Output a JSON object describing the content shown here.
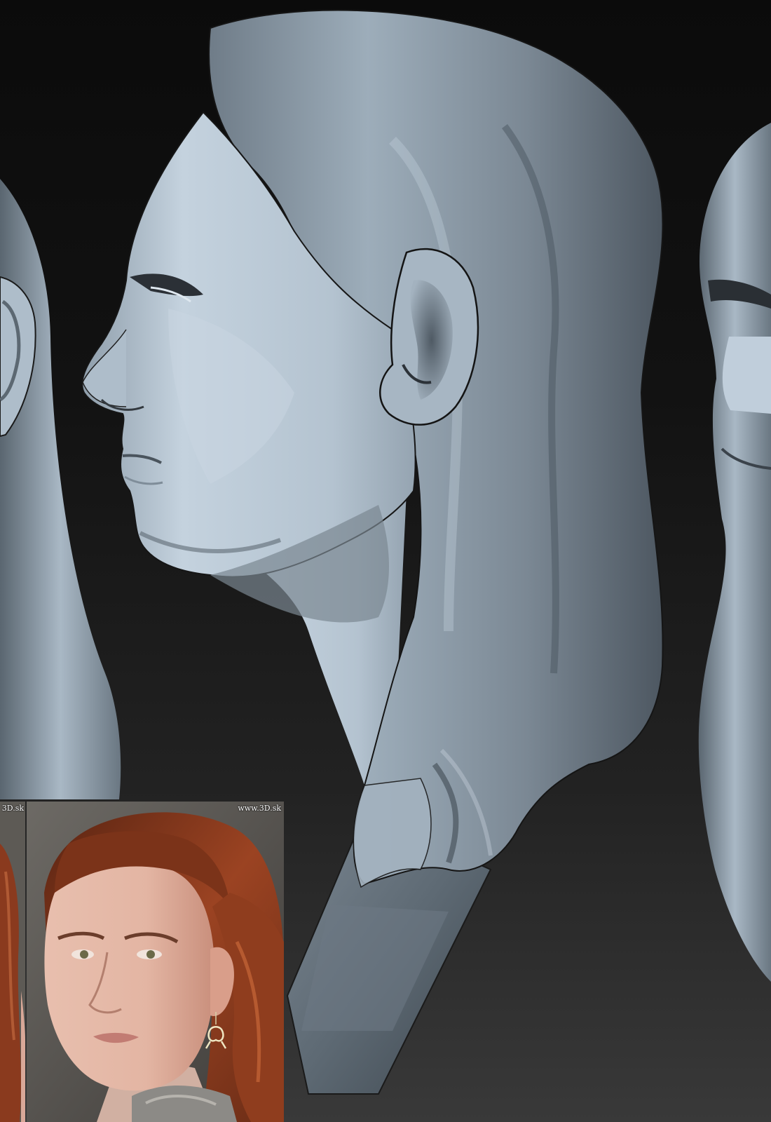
{
  "reference_photos": {
    "left_watermark": "3D.sk",
    "main_watermark": "www.3D.sk"
  },
  "colors": {
    "sculpt_light": "#b8c7d4",
    "sculpt_mid": "#8796a3",
    "sculpt_dark": "#48535d",
    "hair": "#8a3a1e",
    "skin": "#e3b5a3"
  }
}
